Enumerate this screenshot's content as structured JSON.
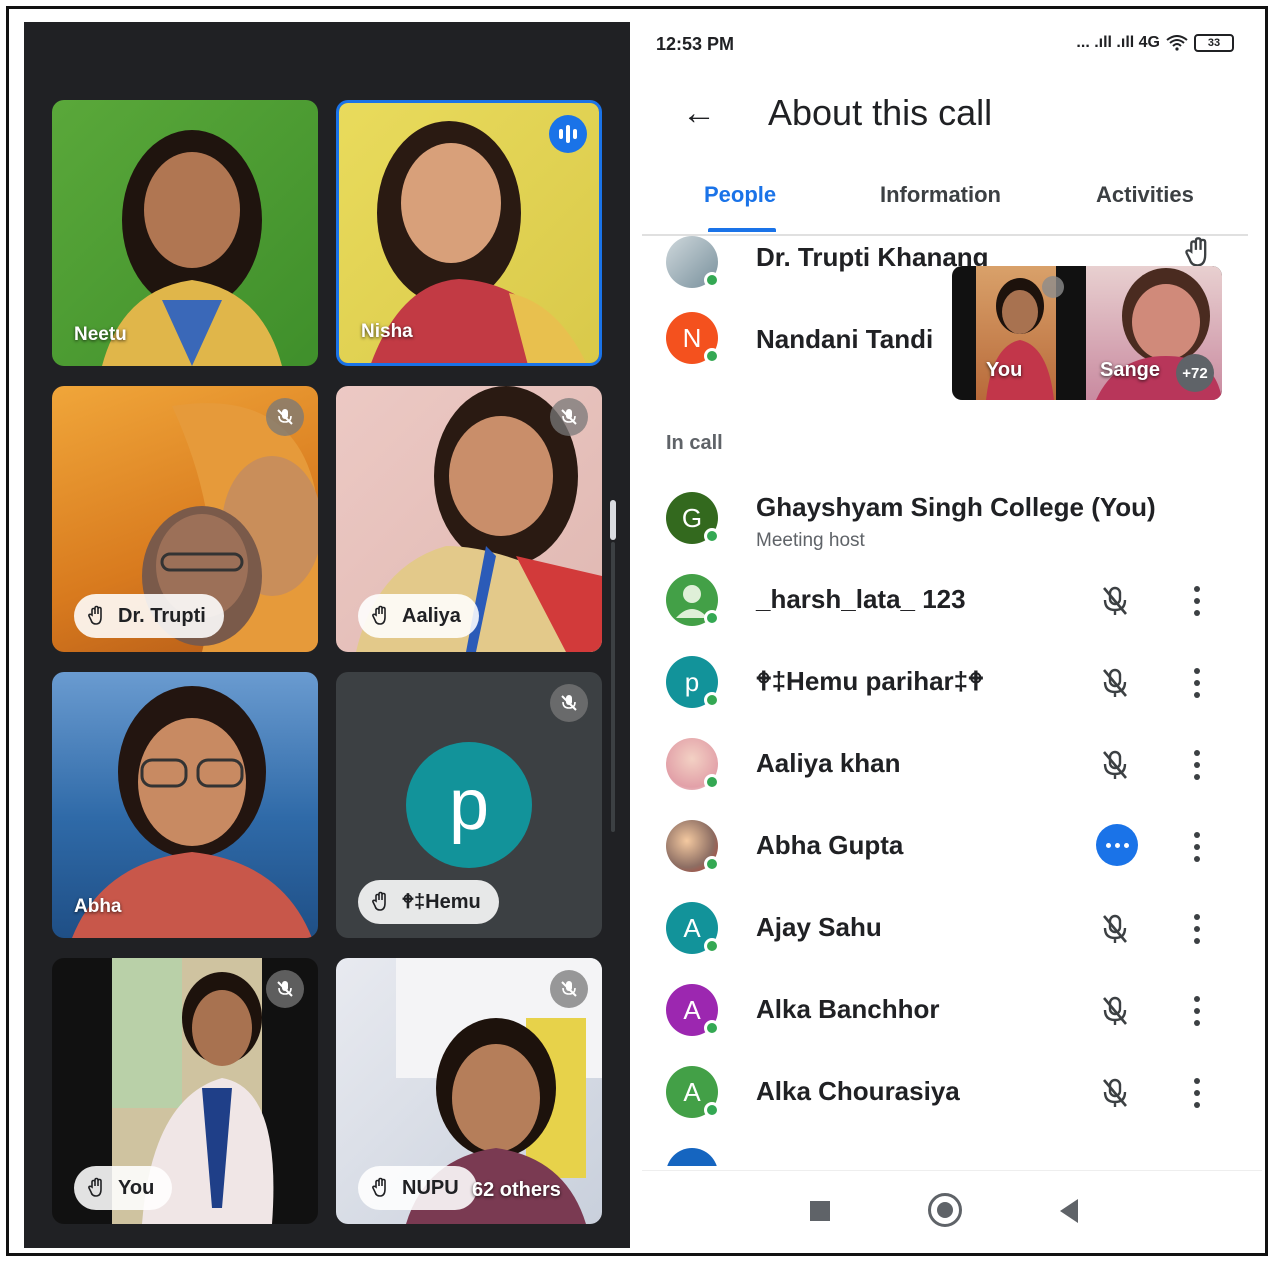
{
  "meet": {
    "tiles": [
      {
        "name": "Neetu",
        "muted": false
      },
      {
        "name": "Nisha",
        "speaking": true
      },
      {
        "name": "Dr. Trupti",
        "muted": true,
        "hand_raised": true
      },
      {
        "name": "Aaliya",
        "muted": true,
        "hand_raised": true
      },
      {
        "name": "Abha",
        "muted": false
      },
      {
        "name": "🕈‡Hemu",
        "avatar_letter": "p",
        "avatar_color": "#12939a",
        "muted": true,
        "hand_raised": true
      },
      {
        "name": "You",
        "muted": true,
        "hand_raised": true
      },
      {
        "name": "NUPU",
        "others_label": "62 others",
        "muted": true,
        "hand_raised": true
      }
    ]
  },
  "phone": {
    "status_time": "12:53 PM",
    "status_network": "... .ıll .ıll 4G",
    "battery": "33",
    "title": "About this call",
    "tabs": [
      "People",
      "Information",
      "Activities"
    ],
    "active_tab": "People",
    "raised_hand_list": [
      {
        "name": "Dr. Trupti Khanang",
        "avatar_type": "photo"
      },
      {
        "name": "Nandani Tandi",
        "letter": "N",
        "color": "#f4511e"
      }
    ],
    "pip": {
      "left_label": "You",
      "right_label": "Sange",
      "more_count": "+72"
    },
    "section_in_call": "In call",
    "participants": [
      {
        "name": "Ghayshyam Singh College (You)",
        "sub": "Meeting host",
        "letter": "G",
        "color": "#33691e",
        "state": "host"
      },
      {
        "name": "_harsh_lata_ 123",
        "letter": "",
        "color": "#43a047",
        "state": "muted"
      },
      {
        "name": "🕈‡Hemu parihar‡🕈",
        "letter": "p",
        "color": "#12939a",
        "state": "muted"
      },
      {
        "name": "Aaliya khan",
        "letter": "",
        "color": "#f8bbd0",
        "state": "muted"
      },
      {
        "name": "Abha Gupta",
        "letter": "",
        "color": "#8d6e63",
        "state": "talking"
      },
      {
        "name": "Ajay Sahu",
        "letter": "A",
        "color": "#12939a",
        "state": "muted"
      },
      {
        "name": "Alka Banchhor",
        "letter": "A",
        "color": "#9c27b0",
        "state": "muted"
      },
      {
        "name": "Alka Chourasiya",
        "letter": "A",
        "color": "#43a047",
        "state": "muted"
      }
    ]
  }
}
